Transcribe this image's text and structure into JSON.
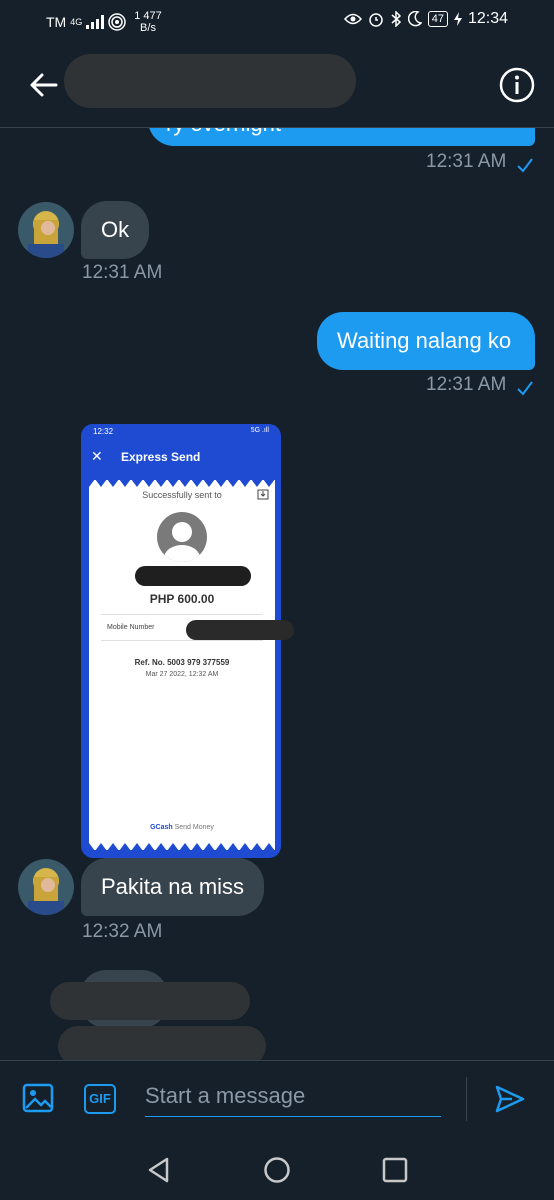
{
  "status_bar": {
    "carrier": "TM",
    "network": "4G",
    "speed_value": "1 477",
    "speed_unit": "B/s",
    "battery": "47",
    "time": "12:34"
  },
  "header": {
    "back_icon": "arrow-left-icon",
    "info_icon": "info-circle-icon"
  },
  "messages": [
    {
      "direction": "out",
      "text": "ry overnight",
      "time": "12:31 AM"
    },
    {
      "direction": "in",
      "text": "Ok",
      "time": "12:31 AM"
    },
    {
      "direction": "out",
      "text": "Waiting nalang ko",
      "time": "12:31 AM"
    },
    {
      "direction": "in",
      "text": "Pakita na miss",
      "time": "12:32 AM"
    }
  ],
  "attachment": {
    "status_time": "12:32",
    "status_right": "5G .ıll",
    "title": "Express Send",
    "sent_to": "Successfully sent to",
    "amount": "PHP 600.00",
    "mobile_label": "Mobile Number",
    "ref": "Ref. No. 5003 979 377559",
    "date": "Mar 27 2022, 12:32 AM",
    "footer_brand": "GCash",
    "footer_text": "Send Money"
  },
  "composer": {
    "placeholder": "Start a message",
    "gif_label": "GIF"
  },
  "colors": {
    "background": "#15202b",
    "outgoing_bubble": "#1d9bf0",
    "incoming_bubble": "#38444d",
    "timestamp": "#8b98a5"
  }
}
